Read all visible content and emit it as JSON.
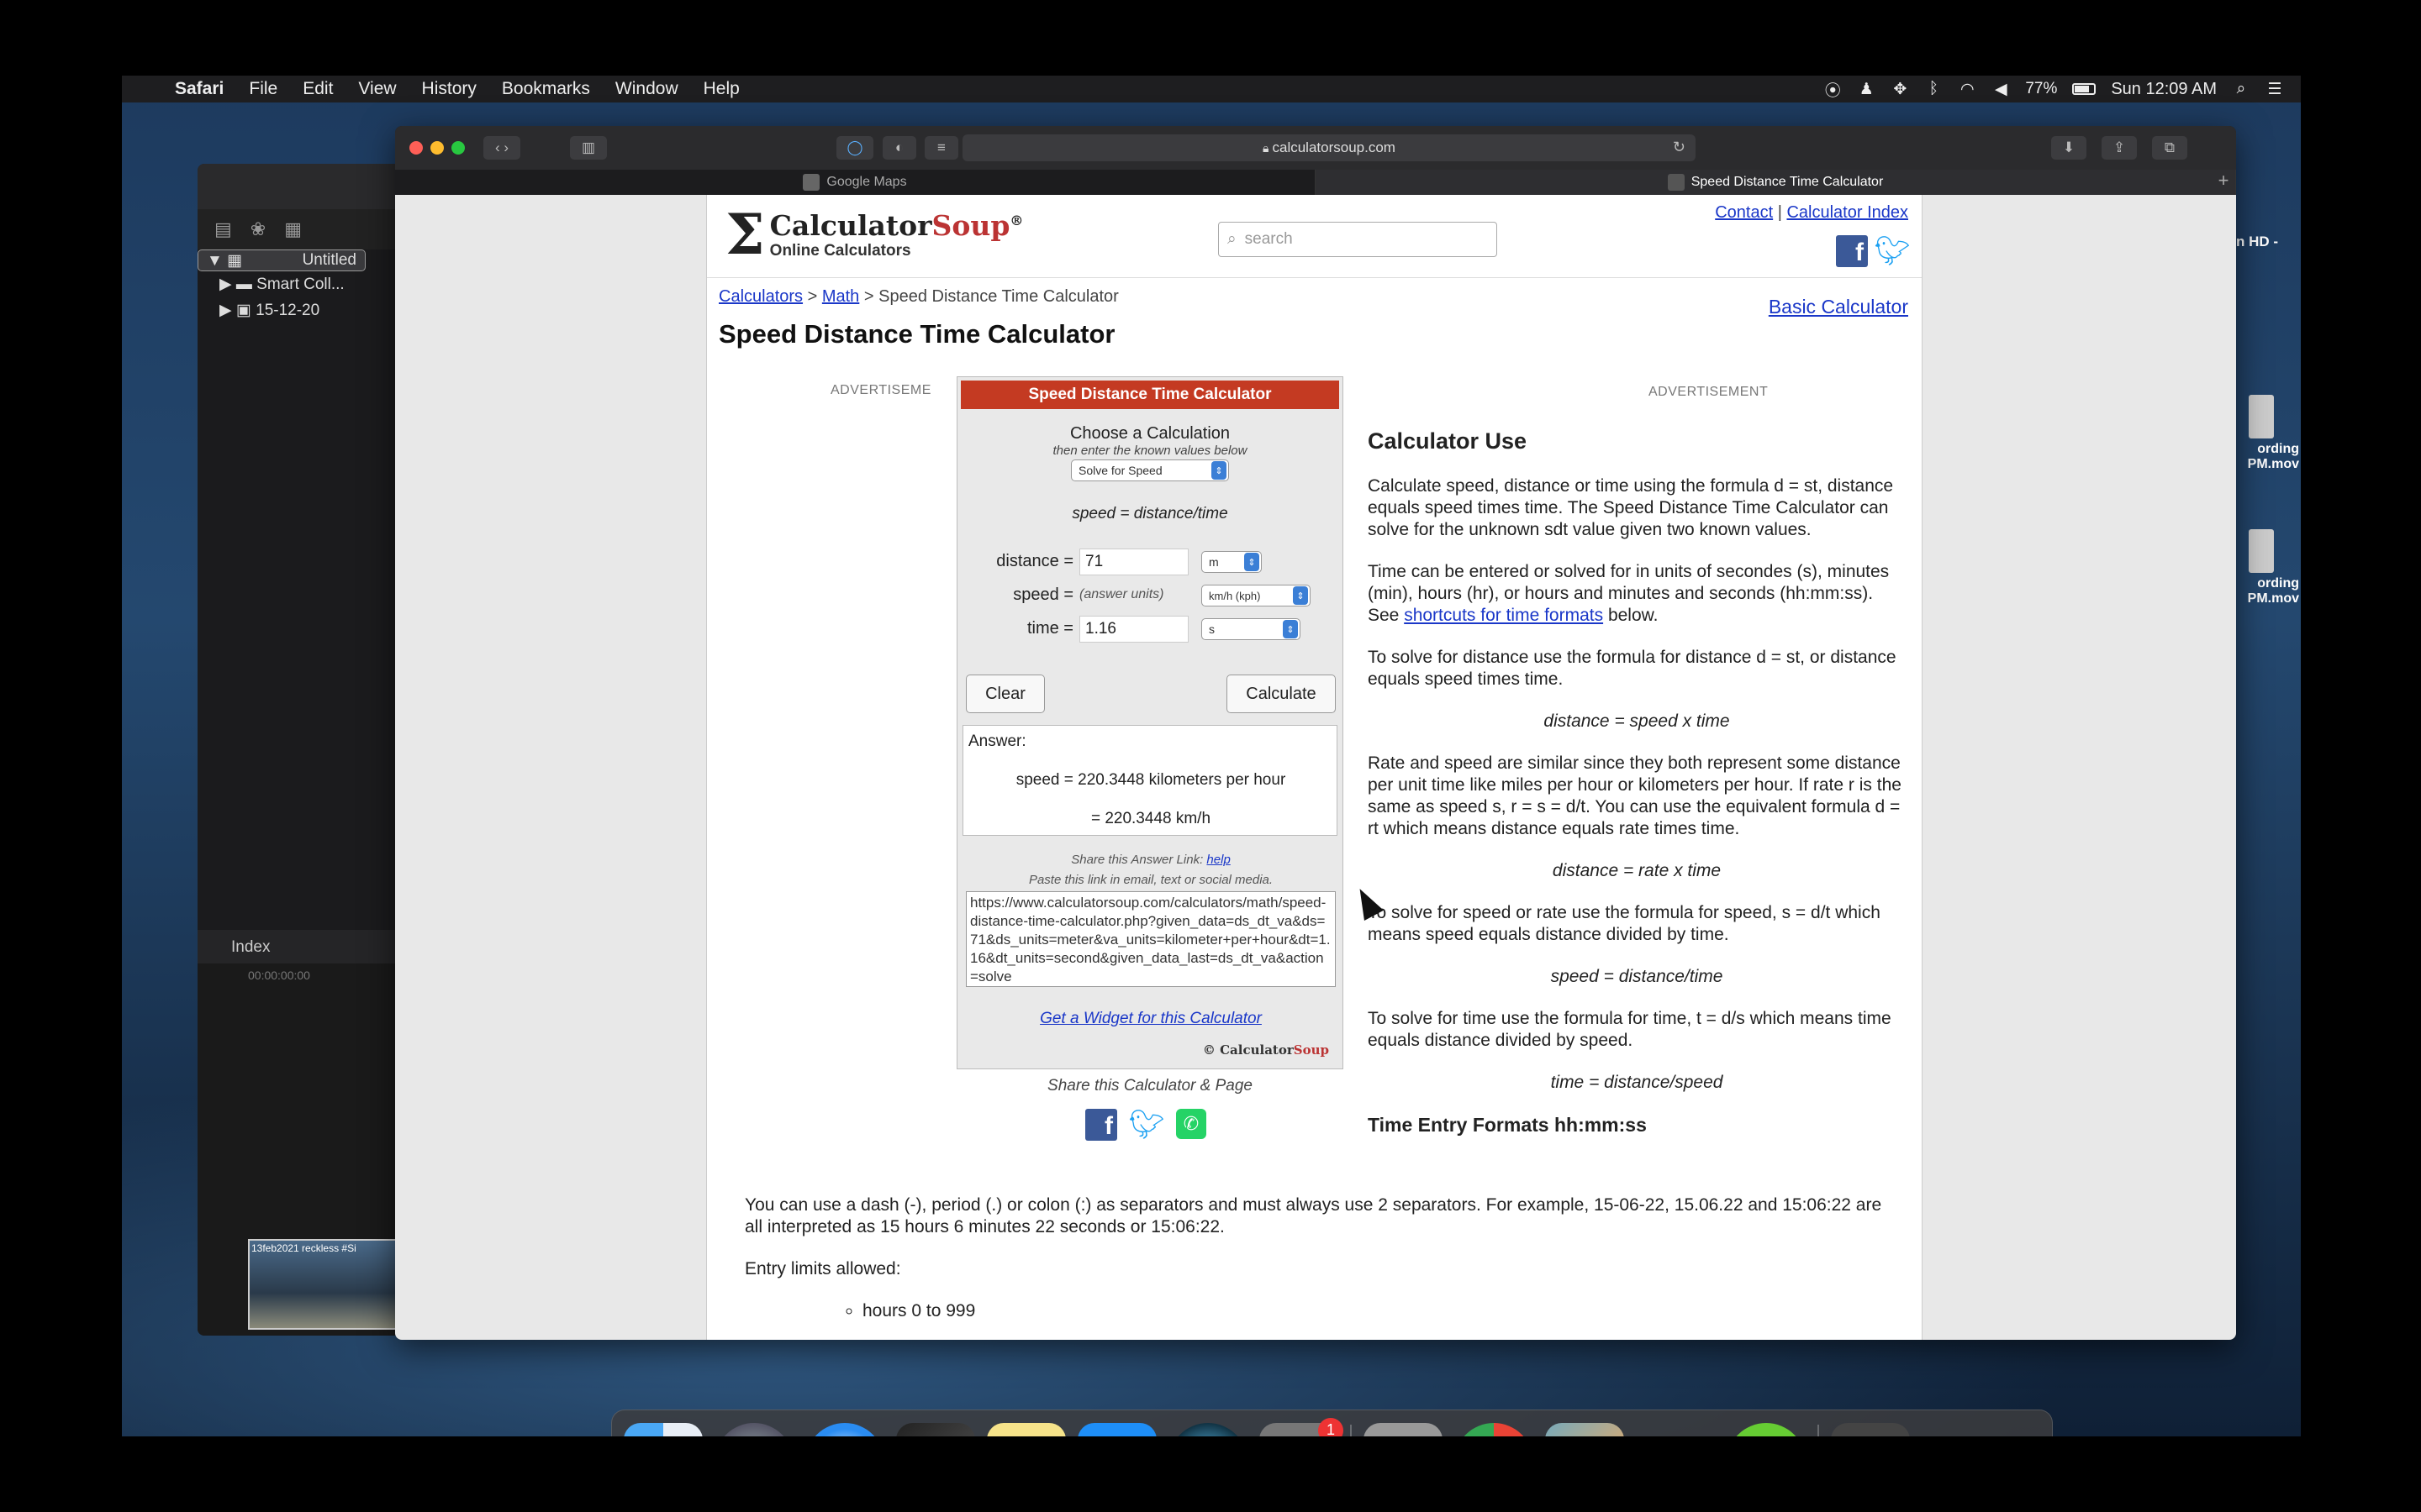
{
  "menubar": {
    "app": "Safari",
    "items": [
      "File",
      "Edit",
      "View",
      "History",
      "Bookmarks",
      "Window",
      "Help"
    ],
    "battery": "77%",
    "clock": "Sun 12:09 AM"
  },
  "bgapp": {
    "library": "Untitled",
    "items": [
      "Smart Coll...",
      "15-12-20"
    ],
    "index_label": "Index",
    "timecode": "00:00:00:00",
    "clip_label": "13feb2021 reckless #Si"
  },
  "desktop": {
    "hd_label": "n HD -",
    "file1": "ording\nPM.mov",
    "file2": "ording\nPM.mov"
  },
  "safari": {
    "address": "calculatorsoup.com",
    "tabs": [
      "Google Maps",
      "Speed Distance Time Calculator"
    ]
  },
  "page": {
    "logo_name": "Calculator",
    "logo_soup": "Soup",
    "logo_reg": "®",
    "logo_sub": "Online Calculators",
    "search_placeholder": "search",
    "contact": "Contact",
    "calc_index": "Calculator Index",
    "crumb": [
      "Calculators",
      "Math",
      "Speed Distance Time Calculator"
    ],
    "basic_calc": "Basic Calculator",
    "title": "Speed Distance Time Calculator",
    "ad_left": "ADVERTISEME",
    "ad_right": "ADVERTISEMENT"
  },
  "calc": {
    "header": "Speed Distance Time Calculator",
    "choose": "Choose a Calculation",
    "hint": "then enter the known values below",
    "solve_for": "Solve for Speed",
    "formula": "speed = distance/time",
    "distance_label": "distance =",
    "distance_value": "71",
    "distance_unit": "m",
    "speed_label": "speed =",
    "speed_hint": "(answer units)",
    "speed_unit": "km/h (kph)",
    "time_label": "time =",
    "time_value": "1.16",
    "time_unit": "s",
    "clear": "Clear",
    "calculate": "Calculate",
    "answer_label": "Answer:",
    "answer_line1": "speed = 220.3448 kilometers per hour",
    "answer_line2": "= 220.3448 km/h",
    "share_link": "Share this Answer Link:",
    "help": "help",
    "paste_hint": "Paste this link in email, text or social media.",
    "url": "https://www.calculatorsoup.com/calculators/math/speed-distance-time-calculator.php?given_data=ds_dt_va&ds=71&ds_units=meter&va_units=kilometer+per+hour&dt=1.16&dt_units=second&given_data_last=ds_dt_va&action=solve",
    "widget": "Get a Widget for this Calculator",
    "copyright": "© Calculator",
    "copyright_soup": "Soup",
    "share_page": "Share this Calculator & Page"
  },
  "content": {
    "h_use": "Calculator Use",
    "p1": "Calculate speed, distance or time using the formula d = st, distance equals speed times time. The Speed Distance Time Calculator can solve for the unknown sdt value given two known values.",
    "p2a": "Time can be entered or solved for in units of secondes (s), minutes (min), hours (hr), or hours and minutes and seconds (hh:mm:ss). See ",
    "p2link": "shortcuts for time formats",
    "p2b": " below.",
    "p3": "To solve for distance use the formula for distance d = st, or distance equals speed times time.",
    "eq1": "distance = speed x time",
    "p4": "Rate and speed are similar since they both represent some distance per unit time like miles per hour or kilometers per hour. If rate r is the same as speed s, r = s = d/t. You can use the equivalent formula d = rt which means distance equals rate times time.",
    "eq2": "distance = rate x time",
    "p5": "To solve for speed or rate use the formula for speed, s = d/t which means speed equals distance divided by time.",
    "eq3": "speed = distance/time",
    "p6": "To solve for time use the formula for time, t = d/s which means time equals distance divided by speed.",
    "eq4": "time = distance/speed",
    "h_formats": "Time Entry Formats hh:mm:ss",
    "p7": "You can use a dash (-), period (.) or colon (:) as separators and must always use 2 separators. For example, 15-06-22, 15.06.22 and 15:06:22 are all interpreted as 15 hours 6 minutes 22 seconds or 15:06:22.",
    "p8": "Entry limits allowed:",
    "li1": "hours 0 to 999"
  },
  "dock": {
    "apps": [
      "finder-icon",
      "launchpad-icon",
      "safari-icon",
      "final-cut-icon",
      "notes-icon",
      "app-store-icon",
      "quicktime-icon",
      "system-preferences-icon",
      "calculator-icon",
      "chrome-icon",
      "preview-icon",
      "vlc-icon",
      "airdrop-icon",
      "downloads-icon",
      "trash-icon"
    ],
    "badge": "1"
  }
}
